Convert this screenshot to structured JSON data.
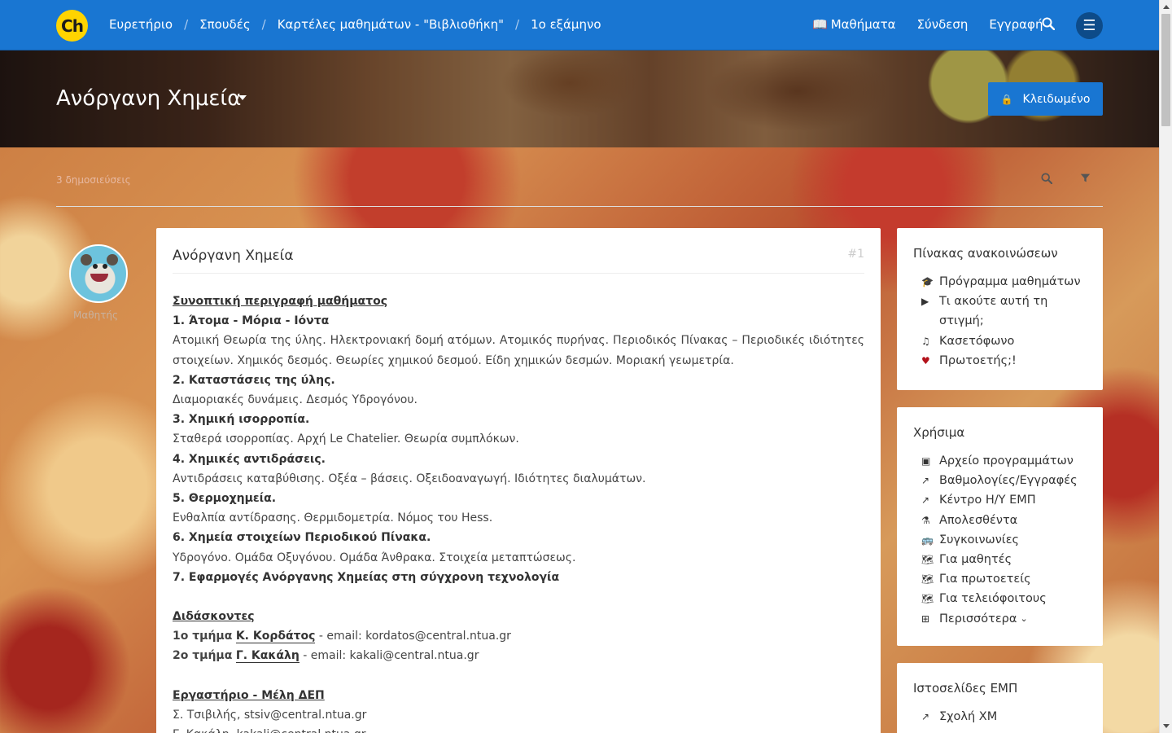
{
  "nav": {
    "logo": "Ch",
    "breadcrumbs": [
      "Ευρετήριο",
      "Σπουδές",
      "Καρτέλες μαθημάτων - \"Βιβλιοθήκη\"",
      "1ο εξάμηνο"
    ],
    "courses_label": "Μαθήματα",
    "login_label": "Σύνδεση",
    "register_label": "Εγγραφή"
  },
  "hero": {
    "title": "Ανόργανη Χημεία",
    "locked_label": "Κλειδωμένο"
  },
  "topic": {
    "post_count": "3 δημοσιεύσεις"
  },
  "post": {
    "author": "Μαθητής",
    "title": "Ανόργανη Χημεία",
    "number": "#1",
    "lines": {
      "summary_heading": "Συνοπτική περιγραφή μαθήματος",
      "s1_title": "1. Άτομα - Μόρια - Ιόντα",
      "s1_text": "Ατομική Θεωρία της ύλης. Ηλεκτρονιακή δομή ατόμων. Ατομικός πυρήνας. Περιοδικός Πίνακας – Περιοδικές ιδιότητες στοιχείων. Χημικός δεσμός. Θεωρίες χημικού δεσμού. Είδη χημικών δεσμών. Μοριακή γεωμετρία.",
      "s2_title": "2. Καταστάσεις της ύλης.",
      "s2_text": "Διαμοριακές δυνάμεις. Δεσμός Υδρογόνου.",
      "s3_title": "3. Χημική ισορροπία.",
      "s3_text": "Σταθερά ισορροπίας. Αρχή Le Chatelier. Θεωρία συμπλόκων.",
      "s4_title": "4. Χημικές αντιδράσεις.",
      "s4_text": "Αντιδράσεις καταβύθισης. Οξέα – βάσεις. Οξειδοαναγωγή. Ιδιότητες διαλυμάτων.",
      "s5_title": "5. Θερμοχημεία.",
      "s5_text": "Ενθαλπία αντίδρασης. Θερμιδομετρία. Νόμος του Hess.",
      "s6_title": "6. Χημεία στοιχείων Περιοδικού Πίνακα.",
      "s6_text": "Υδρογόνο. Ομάδα Οξυγόνου. Ομάδα Άνθρακα. Στοιχεία μεταπτώσεως.",
      "s7_title": "7. Εφαρμογές Ανόργανης Χημείας στη σύγχρονη τεχνολογία",
      "teachers_heading": "Διδάσκοντες",
      "t1_label": "1ο τμήμα",
      "t1_name": "Κ. Κορδάτος",
      "t1_email_label": "- email:",
      "t1_email": "kordatos@central.ntua.gr",
      "t2_label": "2ο τμήμα",
      "t2_name": "Γ. Κακάλη",
      "t2_email_label": "- email:",
      "t2_email": "kakali@central.ntua.gr",
      "lab_heading": "Εργαστήριο - Μέλη ΔΕΠ",
      "lab1": "Σ. Τσιβιλής, stsiv@central.ntua.gr",
      "lab2": "Γ. Κακάλη, kakali@central.ntua.gr"
    }
  },
  "sidebar": {
    "board": {
      "title": "Πίνακας ανακοινώσεων",
      "items": [
        {
          "label": "Πρόγραμμα μαθημάτων",
          "icon": "graduation-cap-icon"
        },
        {
          "label": "Τι ακούτε αυτή τη στιγμή;",
          "icon": "play-circle-icon"
        },
        {
          "label": "Κασετόφωνο",
          "icon": "music-icon"
        },
        {
          "label": "Πρωτοετής;!",
          "icon": "heart-icon"
        }
      ]
    },
    "useful": {
      "title": "Χρήσιμα",
      "items": [
        {
          "label": "Αρχείο προγραμμάτων",
          "icon": "archive-icon"
        },
        {
          "label": "Βαθμολογίες/Εγγραφές",
          "icon": "external-link-icon"
        },
        {
          "label": "Κέντρο Η/Υ ΕΜΠ",
          "icon": "external-link-icon"
        },
        {
          "label": "Απολεσθέντα",
          "icon": "flask-icon"
        },
        {
          "label": "Συγκοινωνίες",
          "icon": "bus-icon"
        },
        {
          "label": "Για μαθητές",
          "icon": "map-icon"
        },
        {
          "label": "Για πρωτοετείς",
          "icon": "map-icon"
        },
        {
          "label": "Για τελειόφοιτους",
          "icon": "map-icon"
        },
        {
          "label": "Περισσότερα",
          "icon": "plus-square-icon"
        }
      ]
    },
    "ntua": {
      "title": "Ιστοσελίδες ΕΜΠ",
      "items": [
        {
          "label": "Σχολή ΧΜ",
          "icon": "external-link-icon"
        }
      ]
    }
  },
  "colors": {
    "navbar": "#1976d2",
    "accent": "#1976d2",
    "heart": "#b3121b"
  }
}
